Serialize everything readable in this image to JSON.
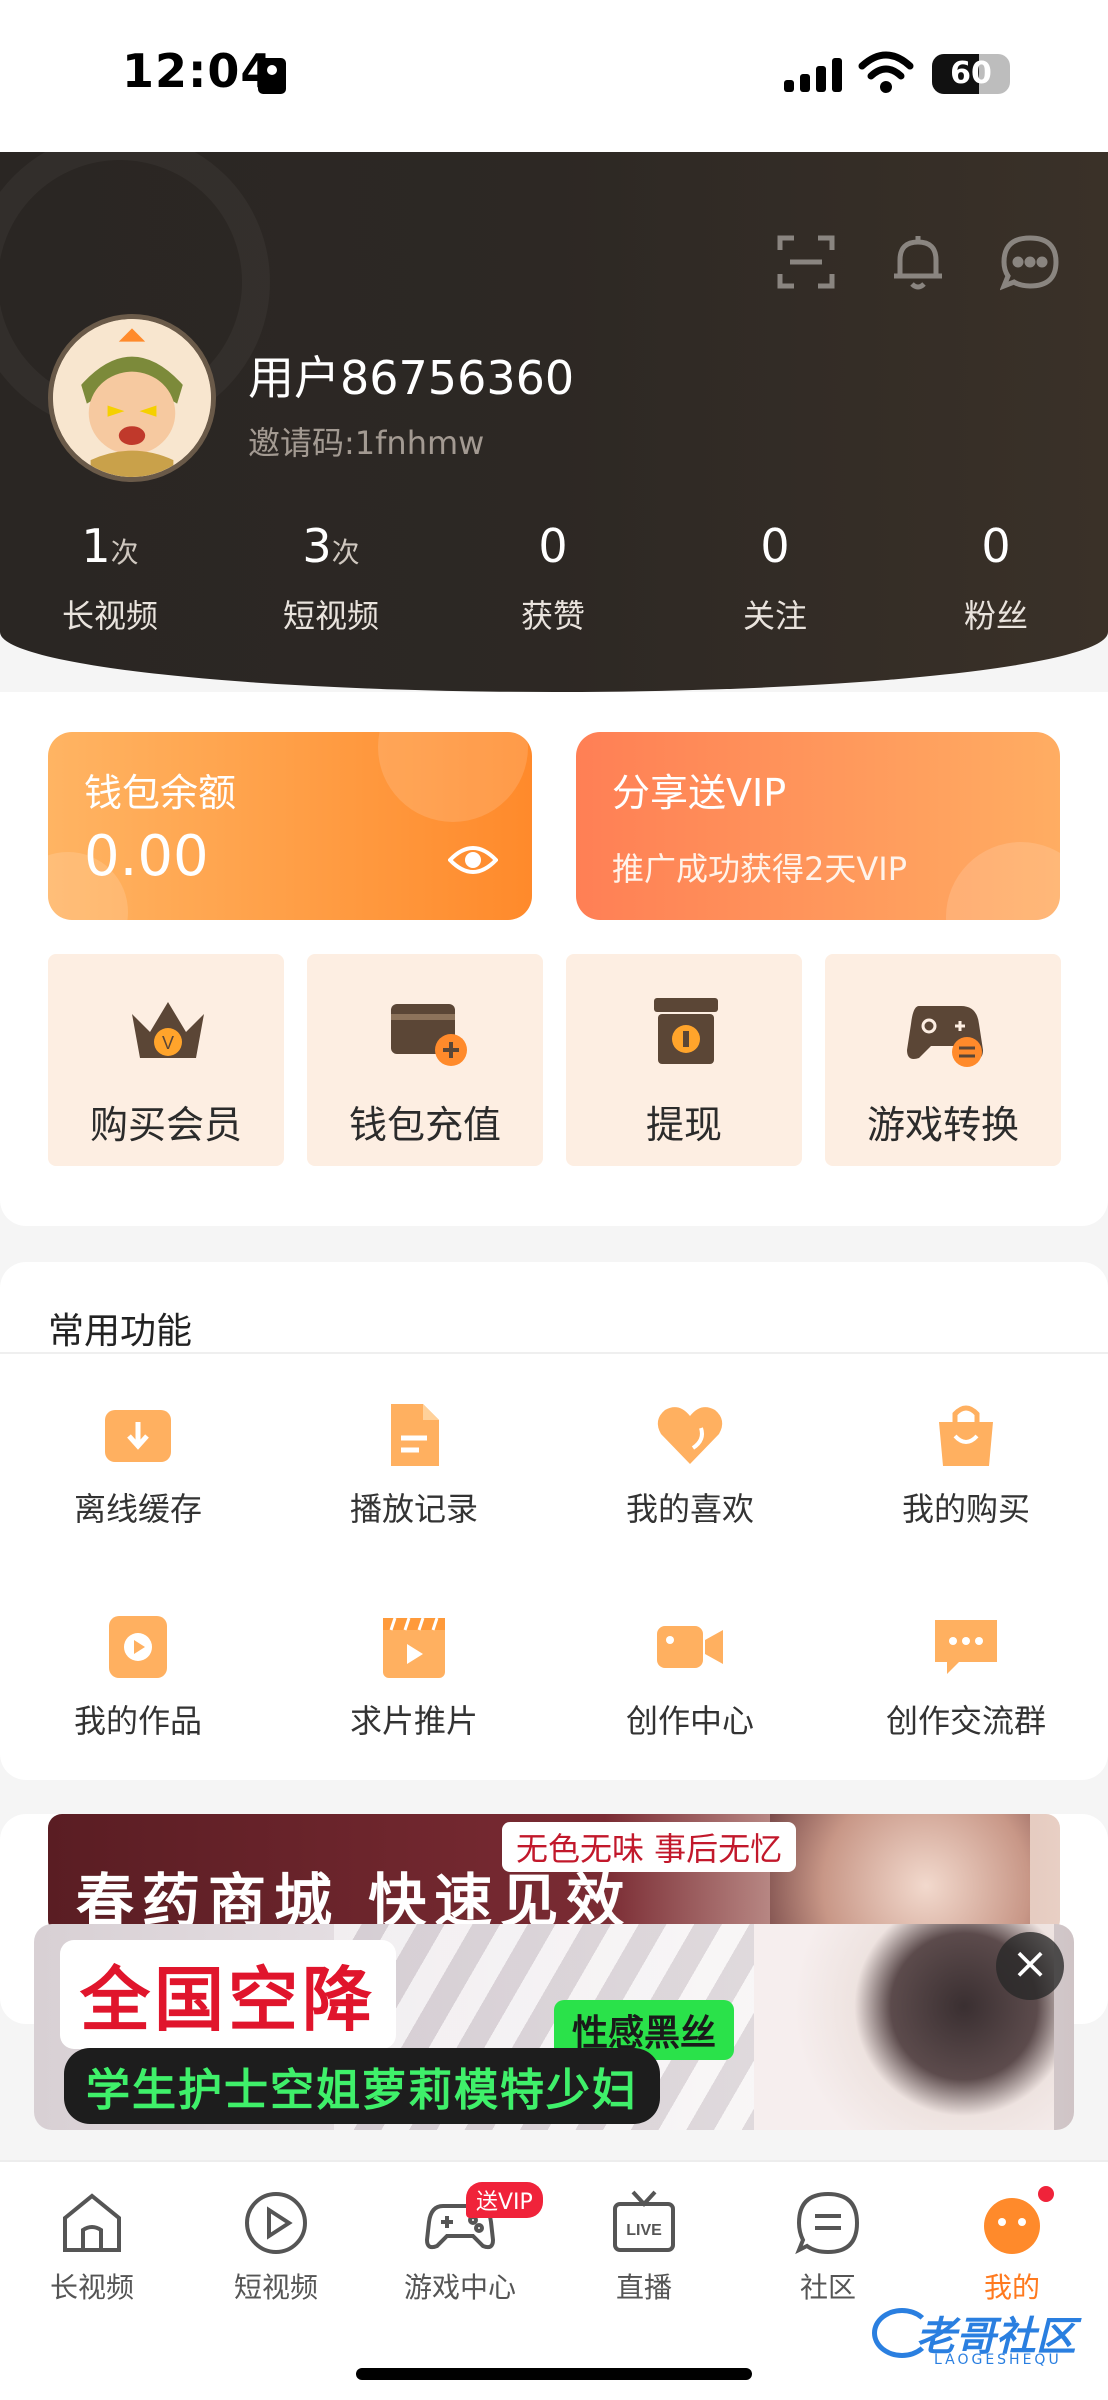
{
  "status_bar": {
    "time": "12:04",
    "battery": "60"
  },
  "profile": {
    "username": "用户86756360",
    "invite_code": "邀请码:1fnhmw",
    "stats": [
      {
        "value": "1",
        "unit": "次",
        "label": "长视频"
      },
      {
        "value": "3",
        "unit": "次",
        "label": "短视频"
      },
      {
        "value": "0",
        "unit": "",
        "label": "获赞"
      },
      {
        "value": "0",
        "unit": "",
        "label": "关注"
      },
      {
        "value": "0",
        "unit": "",
        "label": "粉丝"
      }
    ],
    "header_icons": [
      "scan-icon",
      "bell-icon",
      "message-icon"
    ]
  },
  "wallet": {
    "title": "钱包余额",
    "amount": "0.00",
    "eye_icon": "eye-icon"
  },
  "share": {
    "title": "分享送VIP",
    "subtitle": "推广成功获得2天VIP"
  },
  "quick_actions": [
    {
      "label": "购买会员",
      "icon": "crown-icon"
    },
    {
      "label": "钱包充值",
      "icon": "wallet-add-icon"
    },
    {
      "label": "提现",
      "icon": "withdraw-box-icon"
    },
    {
      "label": "游戏转换",
      "icon": "gamepad-exchange-icon"
    }
  ],
  "common_functions": {
    "title": "常用功能",
    "items": [
      {
        "label": "离线缓存",
        "icon": "download-icon"
      },
      {
        "label": "播放记录",
        "icon": "document-icon"
      },
      {
        "label": "我的喜欢",
        "icon": "heart-icon"
      },
      {
        "label": "我的购买",
        "icon": "shopping-bag-icon"
      },
      {
        "label": "我的作品",
        "icon": "play-square-icon"
      },
      {
        "label": "求片推片",
        "icon": "film-icon"
      },
      {
        "label": "创作中心",
        "icon": "video-camera-icon"
      },
      {
        "label": "创作交流群",
        "icon": "chat-dots-icon"
      }
    ]
  },
  "banner": {
    "headline": "春药商城 快速见效",
    "tagline": "无色无味 事后无忆"
  },
  "popup_ad": {
    "headline": "全国空降",
    "tag": "性感黑丝",
    "subline": "学生护士空姐萝莉模特少妇",
    "close": "×"
  },
  "bottom_nav": {
    "items": [
      {
        "label": "长视频",
        "icon": "home-icon"
      },
      {
        "label": "短视频",
        "icon": "play-circle-icon"
      },
      {
        "label": "游戏中心",
        "icon": "gamepad-icon"
      },
      {
        "label": "直播",
        "icon": "live-tv-icon"
      },
      {
        "label": "社区",
        "icon": "community-chat-icon"
      },
      {
        "label": "我的",
        "icon": "profile-mascot-icon"
      }
    ],
    "badge": "送VIP",
    "active_index": 5
  },
  "watermark": {
    "text": "老哥社区",
    "sub": "LAOGESHEQU"
  },
  "colors": {
    "accent": "#ff7a1f",
    "header_bg": "#2a2623",
    "quick_bg": "#fdeee2",
    "badge_red": "#f0233a"
  }
}
